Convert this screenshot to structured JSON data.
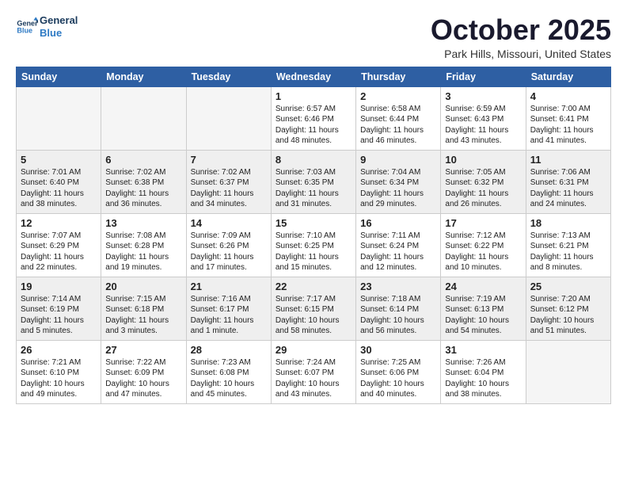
{
  "logo": {
    "line1": "General",
    "line2": "Blue"
  },
  "title": "October 2025",
  "subtitle": "Park Hills, Missouri, United States",
  "weekdays": [
    "Sunday",
    "Monday",
    "Tuesday",
    "Wednesday",
    "Thursday",
    "Friday",
    "Saturday"
  ],
  "weeks": [
    [
      {
        "day": "",
        "info": ""
      },
      {
        "day": "",
        "info": ""
      },
      {
        "day": "",
        "info": ""
      },
      {
        "day": "1",
        "info": "Sunrise: 6:57 AM\nSunset: 6:46 PM\nDaylight: 11 hours\nand 48 minutes."
      },
      {
        "day": "2",
        "info": "Sunrise: 6:58 AM\nSunset: 6:44 PM\nDaylight: 11 hours\nand 46 minutes."
      },
      {
        "day": "3",
        "info": "Sunrise: 6:59 AM\nSunset: 6:43 PM\nDaylight: 11 hours\nand 43 minutes."
      },
      {
        "day": "4",
        "info": "Sunrise: 7:00 AM\nSunset: 6:41 PM\nDaylight: 11 hours\nand 41 minutes."
      }
    ],
    [
      {
        "day": "5",
        "info": "Sunrise: 7:01 AM\nSunset: 6:40 PM\nDaylight: 11 hours\nand 38 minutes."
      },
      {
        "day": "6",
        "info": "Sunrise: 7:02 AM\nSunset: 6:38 PM\nDaylight: 11 hours\nand 36 minutes."
      },
      {
        "day": "7",
        "info": "Sunrise: 7:02 AM\nSunset: 6:37 PM\nDaylight: 11 hours\nand 34 minutes."
      },
      {
        "day": "8",
        "info": "Sunrise: 7:03 AM\nSunset: 6:35 PM\nDaylight: 11 hours\nand 31 minutes."
      },
      {
        "day": "9",
        "info": "Sunrise: 7:04 AM\nSunset: 6:34 PM\nDaylight: 11 hours\nand 29 minutes."
      },
      {
        "day": "10",
        "info": "Sunrise: 7:05 AM\nSunset: 6:32 PM\nDaylight: 11 hours\nand 26 minutes."
      },
      {
        "day": "11",
        "info": "Sunrise: 7:06 AM\nSunset: 6:31 PM\nDaylight: 11 hours\nand 24 minutes."
      }
    ],
    [
      {
        "day": "12",
        "info": "Sunrise: 7:07 AM\nSunset: 6:29 PM\nDaylight: 11 hours\nand 22 minutes."
      },
      {
        "day": "13",
        "info": "Sunrise: 7:08 AM\nSunset: 6:28 PM\nDaylight: 11 hours\nand 19 minutes."
      },
      {
        "day": "14",
        "info": "Sunrise: 7:09 AM\nSunset: 6:26 PM\nDaylight: 11 hours\nand 17 minutes."
      },
      {
        "day": "15",
        "info": "Sunrise: 7:10 AM\nSunset: 6:25 PM\nDaylight: 11 hours\nand 15 minutes."
      },
      {
        "day": "16",
        "info": "Sunrise: 7:11 AM\nSunset: 6:24 PM\nDaylight: 11 hours\nand 12 minutes."
      },
      {
        "day": "17",
        "info": "Sunrise: 7:12 AM\nSunset: 6:22 PM\nDaylight: 11 hours\nand 10 minutes."
      },
      {
        "day": "18",
        "info": "Sunrise: 7:13 AM\nSunset: 6:21 PM\nDaylight: 11 hours\nand 8 minutes."
      }
    ],
    [
      {
        "day": "19",
        "info": "Sunrise: 7:14 AM\nSunset: 6:19 PM\nDaylight: 11 hours\nand 5 minutes."
      },
      {
        "day": "20",
        "info": "Sunrise: 7:15 AM\nSunset: 6:18 PM\nDaylight: 11 hours\nand 3 minutes."
      },
      {
        "day": "21",
        "info": "Sunrise: 7:16 AM\nSunset: 6:17 PM\nDaylight: 11 hours\nand 1 minute."
      },
      {
        "day": "22",
        "info": "Sunrise: 7:17 AM\nSunset: 6:15 PM\nDaylight: 10 hours\nand 58 minutes."
      },
      {
        "day": "23",
        "info": "Sunrise: 7:18 AM\nSunset: 6:14 PM\nDaylight: 10 hours\nand 56 minutes."
      },
      {
        "day": "24",
        "info": "Sunrise: 7:19 AM\nSunset: 6:13 PM\nDaylight: 10 hours\nand 54 minutes."
      },
      {
        "day": "25",
        "info": "Sunrise: 7:20 AM\nSunset: 6:12 PM\nDaylight: 10 hours\nand 51 minutes."
      }
    ],
    [
      {
        "day": "26",
        "info": "Sunrise: 7:21 AM\nSunset: 6:10 PM\nDaylight: 10 hours\nand 49 minutes."
      },
      {
        "day": "27",
        "info": "Sunrise: 7:22 AM\nSunset: 6:09 PM\nDaylight: 10 hours\nand 47 minutes."
      },
      {
        "day": "28",
        "info": "Sunrise: 7:23 AM\nSunset: 6:08 PM\nDaylight: 10 hours\nand 45 minutes."
      },
      {
        "day": "29",
        "info": "Sunrise: 7:24 AM\nSunset: 6:07 PM\nDaylight: 10 hours\nand 43 minutes."
      },
      {
        "day": "30",
        "info": "Sunrise: 7:25 AM\nSunset: 6:06 PM\nDaylight: 10 hours\nand 40 minutes."
      },
      {
        "day": "31",
        "info": "Sunrise: 7:26 AM\nSunset: 6:04 PM\nDaylight: 10 hours\nand 38 minutes."
      },
      {
        "day": "",
        "info": ""
      }
    ]
  ]
}
